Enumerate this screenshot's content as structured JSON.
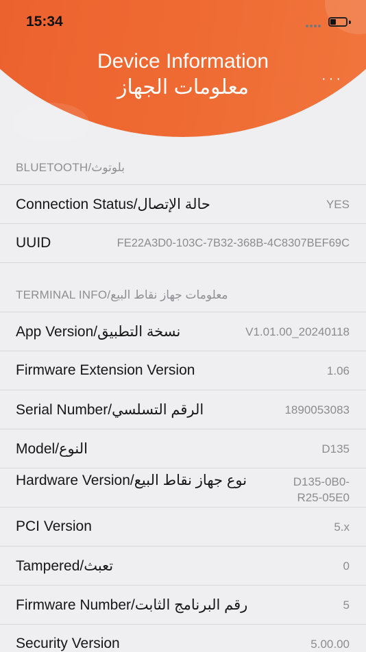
{
  "status_bar": {
    "time": "15:34"
  },
  "header": {
    "title_en": "Device Information",
    "title_ar": "معلومات الجهاز",
    "more_label": "···"
  },
  "sections": {
    "bluetooth": {
      "header": "BLUETOOTH/بلوتوث",
      "rows": [
        {
          "label": "Connection Status/حالة الإتصال",
          "value": "YES"
        },
        {
          "label": "UUID",
          "value": "FE22A3D0-103C-7B32-368B-4C8307BEF69C"
        }
      ]
    },
    "terminal": {
      "header": "TERMINAL INFO/معلومات جهاز نقاط البيع",
      "rows": [
        {
          "label": "App Version/نسخة التطبيق",
          "value": "V1.01.00_20240118"
        },
        {
          "label": "Firmware Extension Version",
          "value": "1.06"
        },
        {
          "label": "Serial Number/الرقم التسلسي",
          "value": "1890053083"
        },
        {
          "label": "Model/النوع",
          "value": "D135"
        },
        {
          "label": "Hardware Version/نوع جهاز نقاط البيع",
          "value": "D135-0B0-R25-05E0"
        },
        {
          "label": "PCI Version",
          "value": "5.x"
        },
        {
          "label": "Tampered/تعبث",
          "value": "0"
        },
        {
          "label": "Firmware Number/رقم البرنامج الثابت",
          "value": "5"
        },
        {
          "label": "Security Version",
          "value": "5.00.00"
        }
      ]
    }
  }
}
